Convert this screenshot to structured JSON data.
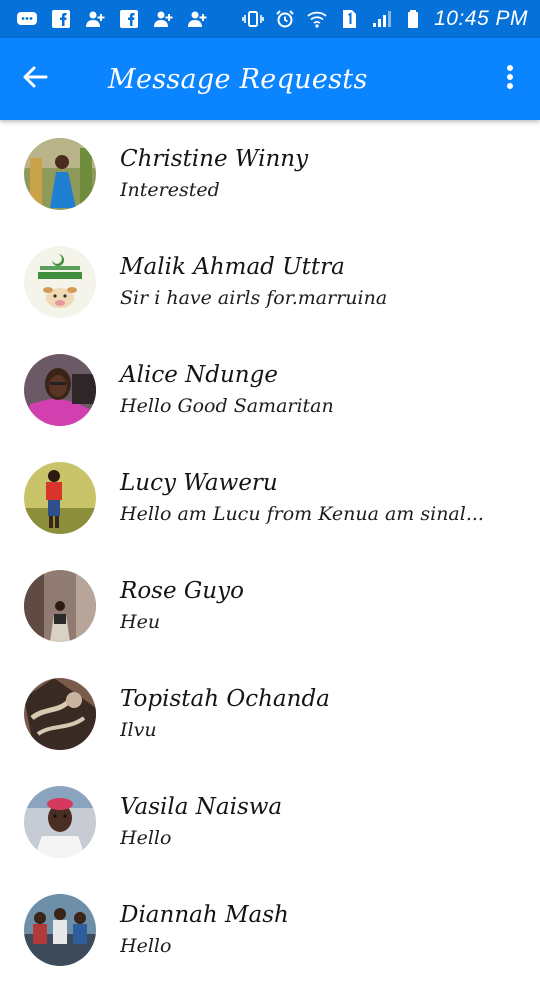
{
  "status_bar": {
    "time": "10:45 PM",
    "icons": [
      "messenger-icon",
      "facebook-icon",
      "add-friend-icon",
      "facebook-icon",
      "add-friend-icon",
      "add-friend-icon",
      "vibrate-icon",
      "alarm-icon",
      "wifi-icon",
      "sim-icon",
      "signal-icon",
      "battery-icon"
    ]
  },
  "app_bar": {
    "title": "Message Requests",
    "back_icon": "back-arrow-icon",
    "menu_icon": "more-vert-icon"
  },
  "requests": [
    {
      "name": "Christine Winny",
      "message": "Interested"
    },
    {
      "name": "Malik Ahmad Uttra",
      "message": "Sir i have airls for.marruina"
    },
    {
      "name": "Alice Ndunge",
      "message": "Hello Good Samaritan"
    },
    {
      "name": "Lucy Waweru",
      "message": "Hello  am Lucu from Kenua am sinal..."
    },
    {
      "name": "Rose Guyo",
      "message": "Heu"
    },
    {
      "name": "Topistah Ochanda",
      "message": "Ilvu"
    },
    {
      "name": "Vasila Naiswa",
      "message": "Hello"
    },
    {
      "name": "Diannah Mash",
      "message": "Hello"
    }
  ],
  "colors": {
    "status_bar": "#0571d9",
    "app_bar": "#0a84ff",
    "text": "#141414"
  }
}
